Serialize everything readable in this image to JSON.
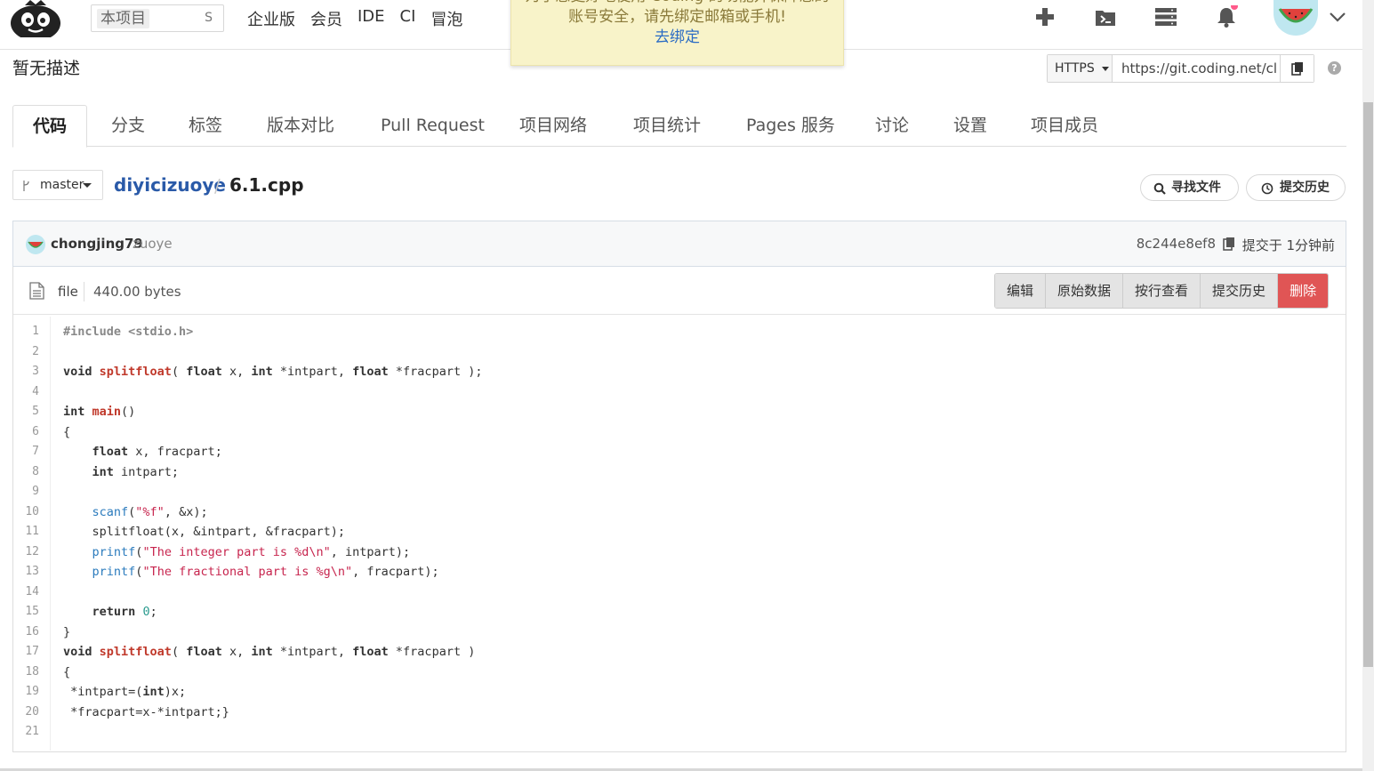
{
  "topbar": {
    "search_scope": "本项目",
    "search_shortcut": "S",
    "nav": [
      "企业版",
      "会员",
      "IDE",
      "CI",
      "冒泡"
    ]
  },
  "notice": {
    "line1": "为了您更好地使用 Coding 的功能并保障您的",
    "line2": "账号安全，请先绑定邮箱或手机!",
    "link": "去绑定"
  },
  "project": {
    "description": "暂无描述",
    "clone_protocol": "HTTPS",
    "clone_url": "https://git.coding.net/cl"
  },
  "tabs": [
    "代码",
    "分支",
    "标签",
    "版本对比",
    "Pull Request",
    "项目网络",
    "项目统计",
    "Pages 服务",
    "讨论",
    "设置",
    "项目成员"
  ],
  "breadcrumb": {
    "branch": "master",
    "repo": "diyicizuoye",
    "separator": "/",
    "file": "6.1.cpp",
    "find_file": "寻找文件",
    "history": "提交历史"
  },
  "commit": {
    "author": "chongjing79",
    "message": "zuoye",
    "sha": "8c244e8ef8",
    "time": "提交于 1分钟前"
  },
  "file": {
    "type": "file",
    "size": "440.00 bytes",
    "actions": [
      "编辑",
      "原始数据",
      "按行查看",
      "提交历史",
      "删除"
    ]
  },
  "code_lines": [
    "#include <stdio.h>",
    "",
    "void splitfloat( float x, int *intpart, float *fracpart );",
    "",
    "int main()",
    "{",
    "    float x, fracpart;",
    "    int intpart;",
    "",
    "    scanf(\"%f\", &x);",
    "    splitfloat(x, &intpart, &fracpart);",
    "    printf(\"The integer part is %d\\n\", intpart);",
    "    printf(\"The fractional part is %g\\n\", fracpart);",
    "",
    "    return 0;",
    "}",
    "void splitfloat( float x, int *intpart, float *fracpart )",
    "{",
    " *intpart=(int)x;",
    " *fracpart=x-*intpart;}",
    ""
  ],
  "colors": {
    "accent_blue": "#2a5aa8",
    "danger": "#e05555",
    "notice_bg": "#f8f3c9"
  }
}
